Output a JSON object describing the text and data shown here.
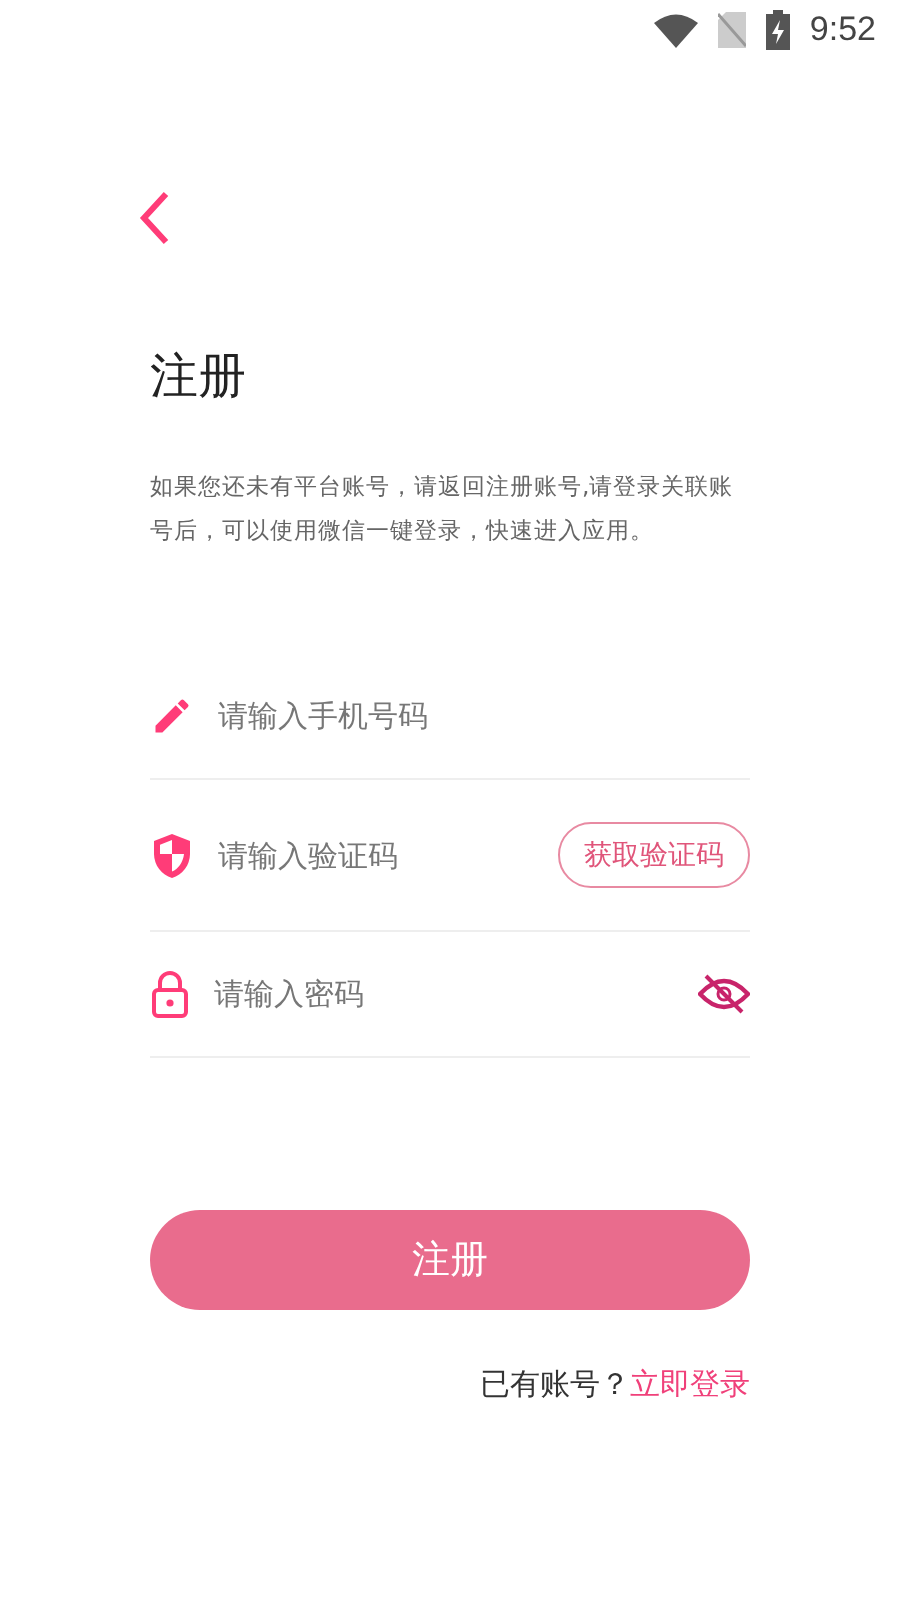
{
  "status_bar": {
    "time": "9:52"
  },
  "title": "注册",
  "description": "如果您还未有平台账号，请返回注册账号,请登录关联账号后，可以使用微信一键登录，快速进入应用。",
  "fields": [
    {
      "kind": "phone",
      "placeholder": "请输入手机号码"
    },
    {
      "kind": "code",
      "placeholder": "请输入验证码",
      "action": "获取验证码"
    },
    {
      "kind": "password",
      "placeholder": "请输入密码",
      "password_visible": false
    }
  ],
  "submit": "注册",
  "footer": {
    "prompt": "已有账号？",
    "link": "立即登录"
  }
}
